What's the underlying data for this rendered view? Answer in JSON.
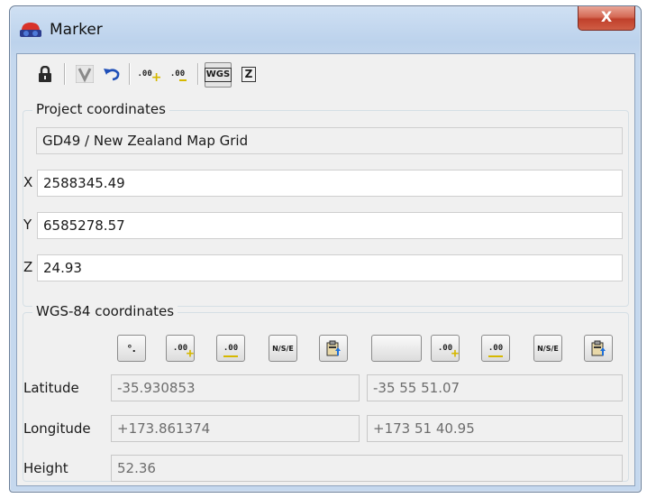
{
  "window": {
    "title": "Marker",
    "close_label": "X"
  },
  "toolbar": {
    "wgs_label": "WGS",
    "z_label": "Z",
    "oo_label": ".00"
  },
  "project": {
    "group_title": "Project coordinates",
    "system": "GD49 / New Zealand Map Grid",
    "x_label": "X",
    "x_value": "2588345.49",
    "y_label": "Y",
    "y_value": "6585278.57",
    "z_label": "Z",
    "z_value": "24.93"
  },
  "wgs": {
    "group_title": "WGS-84 coordinates",
    "deg_label": "°.",
    "nse_label": "N/S/E",
    "latitude_label": "Latitude",
    "latitude_decimal": "-35.930853",
    "latitude_dms": "-35 55 51.07",
    "longitude_label": "Longitude",
    "longitude_decimal": "+173.861374",
    "longitude_dms": "+173 51 40.95",
    "height_label": "Height",
    "height_value": "52.36"
  },
  "colors": {
    "title_gradient_top": "#cfe0f3",
    "close_red": "#c0402b",
    "accent_yellow": "#d6b800"
  }
}
